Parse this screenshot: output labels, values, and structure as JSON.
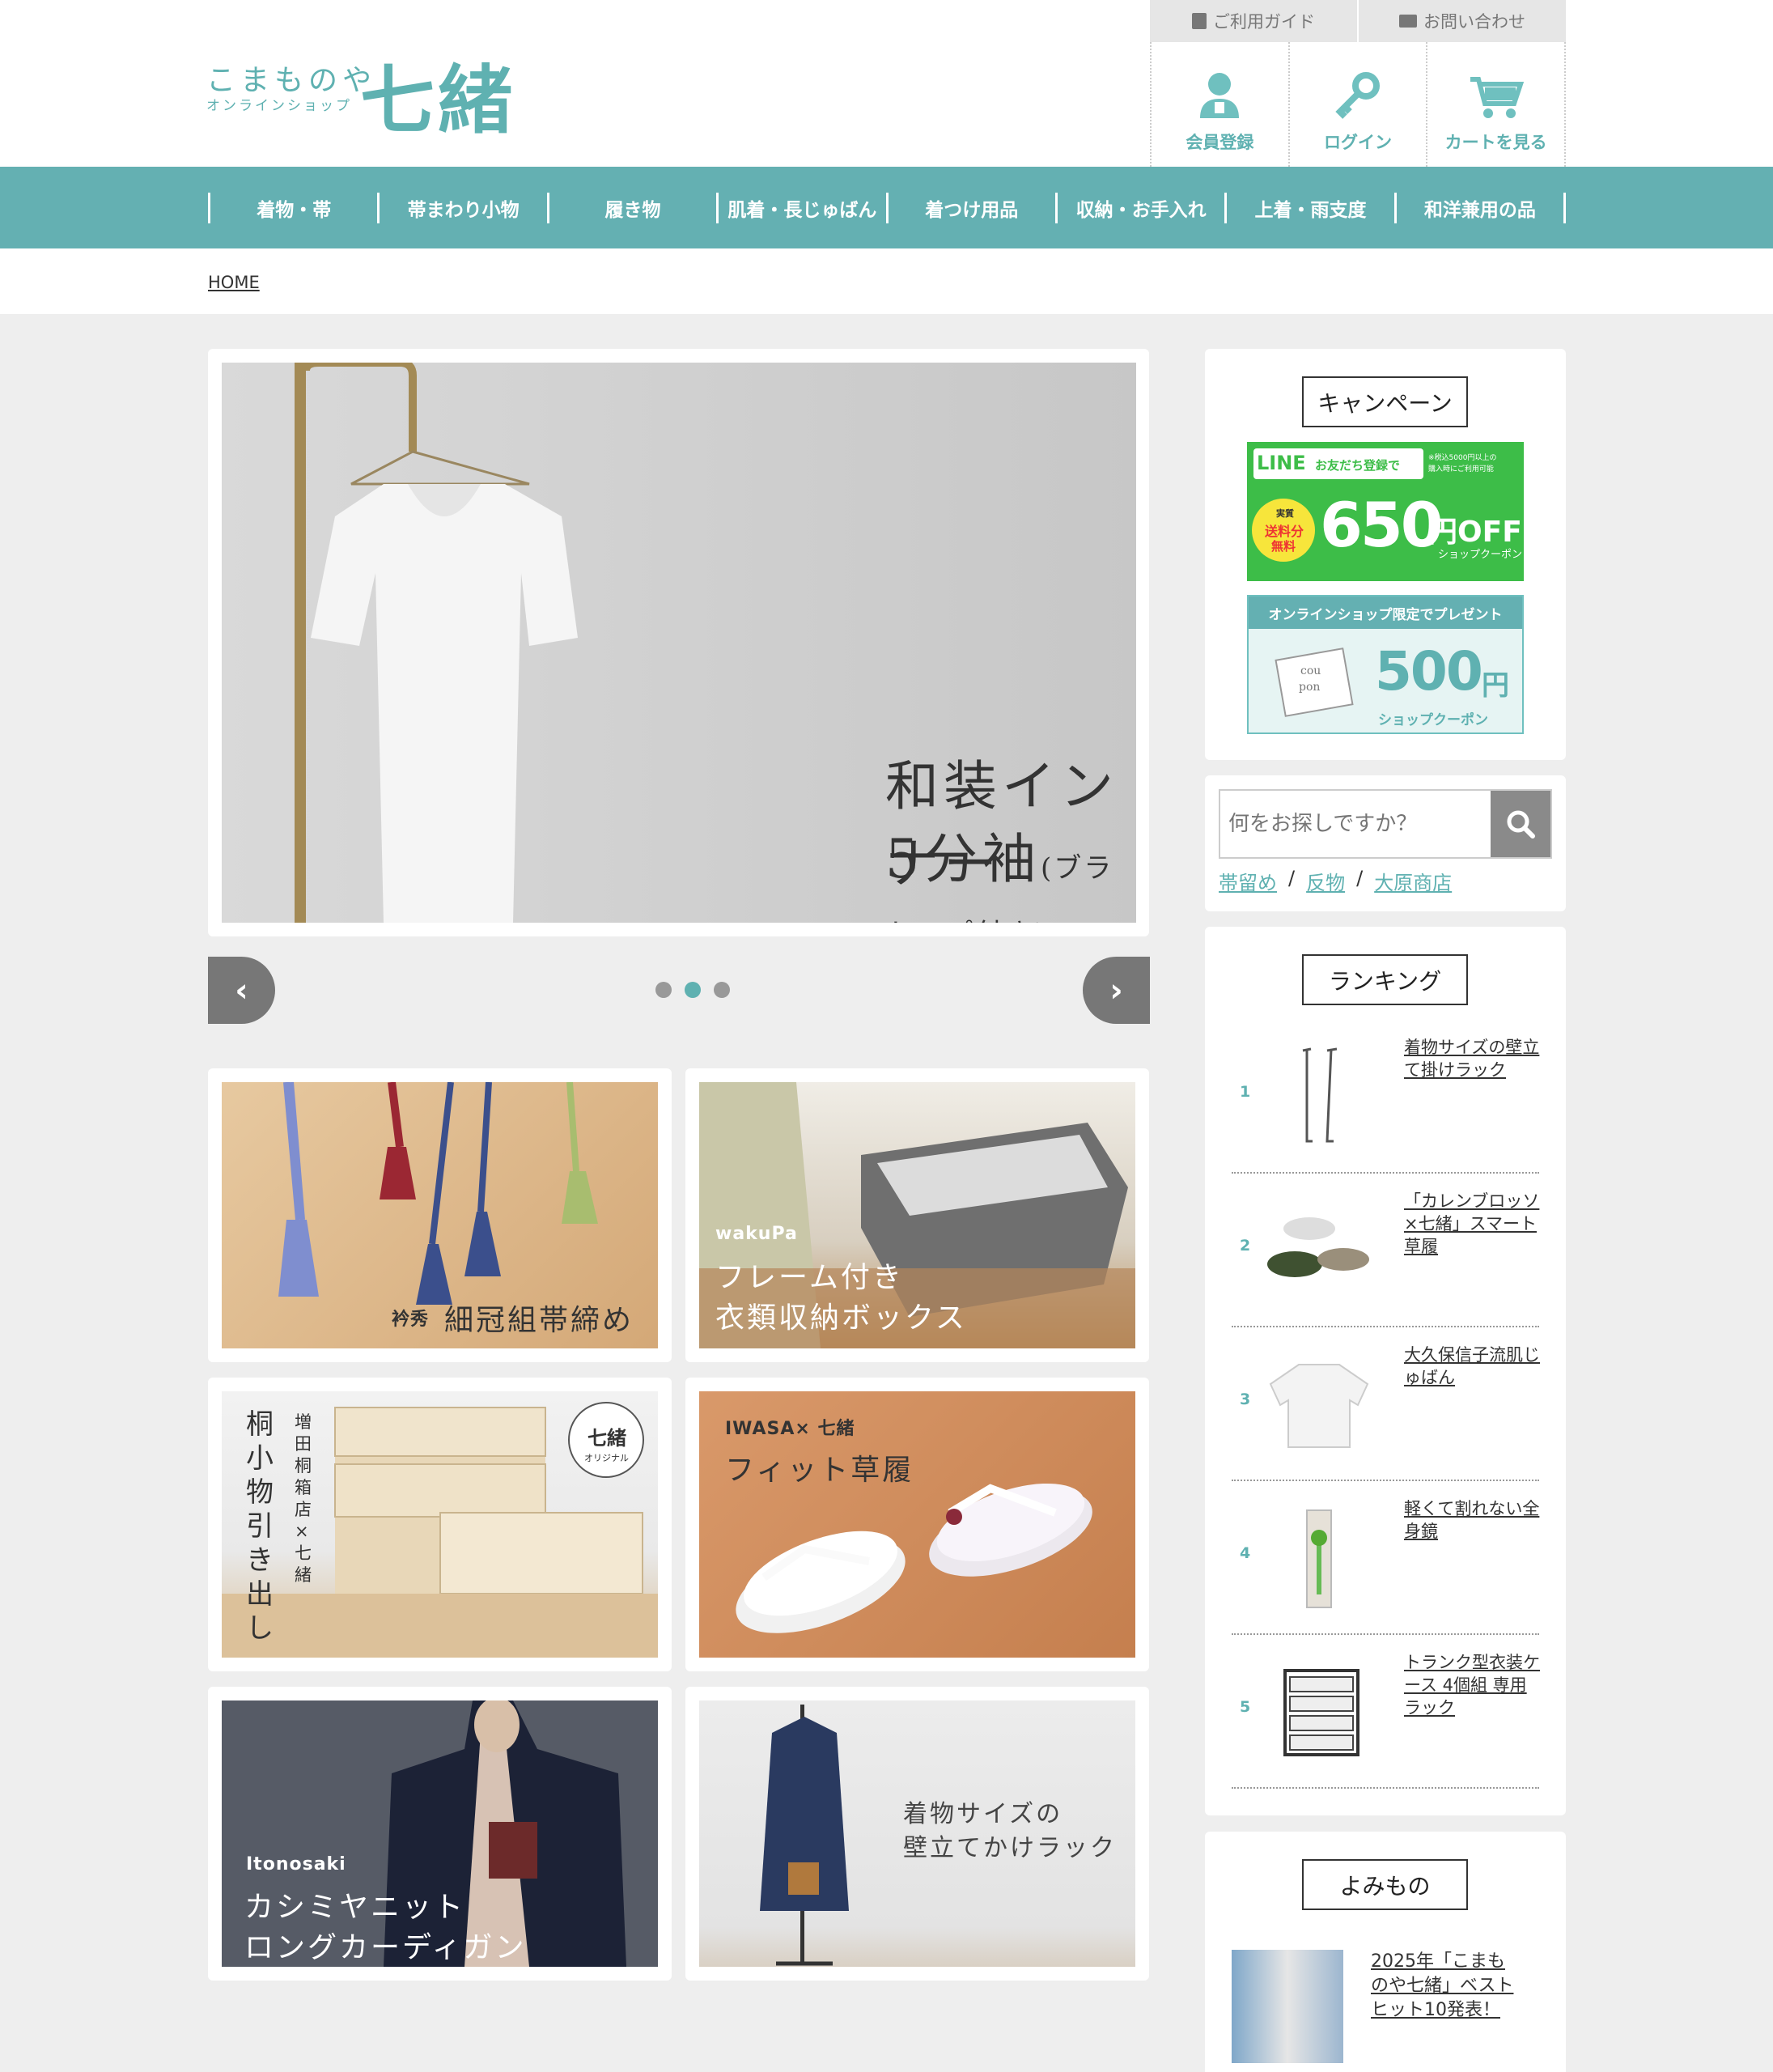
{
  "header": {
    "logo_small": "こまものや",
    "logo_sub": "オンラインショップ",
    "logo_big": "七緒",
    "util_links": [
      "ご利用ガイド",
      "お問い合わせ"
    ],
    "member_links": [
      "会員登録",
      "ログイン",
      "カートを見る"
    ]
  },
  "nav": {
    "items": [
      "着物・帯",
      "帯まわり小物",
      "履き物",
      "肌着・長じゅばん",
      "着つけ用品",
      "収納・お手入れ",
      "上着・雨支度",
      "和洋兼用の品"
    ]
  },
  "breadcrumb": "HOME",
  "slider": {
    "line1": "和装インナー",
    "line2": "5分袖",
    "line2_note": "(ブラトップ付き)",
    "prev": "‹",
    "next": "›",
    "dots": 3,
    "active_index": 1
  },
  "banners": [
    {
      "small": "衿秀",
      "title": "細冠組帯締め"
    },
    {
      "small": "wakuPa",
      "title1": "フレーム付き",
      "title2": "衣類収納ボックス"
    },
    {
      "vertical_main": "桐小物引き出し",
      "vertical_sub": "増田桐箱店×七緒",
      "badge1": "七緒",
      "badge2": "オリジナル"
    },
    {
      "small": "IWASA× 七緒",
      "title": "フィット草履"
    },
    {
      "small": "Itonosaki",
      "title1": "カシミヤニット",
      "title2": "ロングカーディガン"
    },
    {
      "title1": "着物サイズの",
      "title2": "壁立てかけラック"
    }
  ],
  "sidebar": {
    "campaign_title": "キャンペーン",
    "line_banner": {
      "head": "LINE",
      "head2": "お友だち登録で",
      "note1": "※税込5000円以上の",
      "note2": "購入時にご利用可能",
      "badge1": "実質",
      "badge2": "送料分",
      "badge3": "無料",
      "amount": "650",
      "unit": "円OFF",
      "coupon": "ショップクーポン"
    },
    "coupon_banner": {
      "head": "オンラインショップ限定でプレゼント",
      "card1": "cou",
      "card2": "pon",
      "amount": "500",
      "unit": "円",
      "coupon": "ショップクーポン"
    },
    "search_placeholder": "何をお探しですか？",
    "tags": [
      "帯留め",
      "反物",
      "大原商店"
    ],
    "tag_sep": "/",
    "ranking_title": "ランキング",
    "ranking": [
      {
        "rank": "1",
        "name": "着物サイズの壁立て掛けラック"
      },
      {
        "rank": "2",
        "name": "「カレンブロッソ×七緒」スマート草履"
      },
      {
        "rank": "3",
        "name": "大久保信子流肌じゅばん"
      },
      {
        "rank": "4",
        "name": "軽くて割れない全身鏡"
      },
      {
        "rank": "5",
        "name": "トランク型衣装ケース 4個組 専用ラック"
      }
    ],
    "yomimono_title": "よみもの",
    "yomimono_item": "2025年「こまものや七緒」ベストヒット10発表！"
  },
  "colors": {
    "accent": "#64b0b2",
    "teal_text": "#5fb1b1",
    "line_green": "#3dbd48"
  }
}
